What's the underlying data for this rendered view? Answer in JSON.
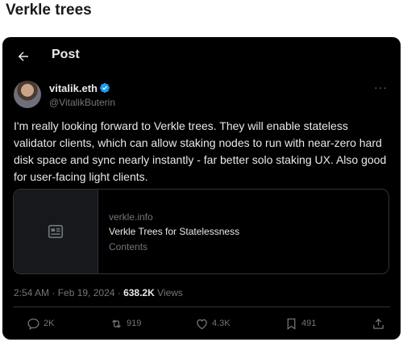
{
  "page": {
    "heading": "Verkle trees"
  },
  "nav": {
    "title": "Post",
    "back_icon": "arrow-left-icon"
  },
  "author": {
    "name": "vitalik.eth",
    "handle": "@VitalikButerin",
    "verified_color": "#1d9bf0",
    "more_label": "···"
  },
  "tweet": {
    "text": "I'm really looking forward to Verkle trees. They will enable stateless validator clients, which can allow staking nodes to run with near-zero hard disk space and sync nearly instantly - far better solo staking UX. Also good for user-facing light clients."
  },
  "link_card": {
    "domain": "verkle.info",
    "title": "Verkle Trees for Statelessness",
    "description": "Contents"
  },
  "meta": {
    "timestamp": "2:54 AM · Feb 19, 2024 · ",
    "views_count": "638.2K",
    "views_label": " Views"
  },
  "actions": {
    "replies": "2K",
    "reposts": "919",
    "likes": "4.3K",
    "bookmarks": "491"
  },
  "colors": {
    "card_bg": "#000000",
    "text": "#e7e9ea",
    "muted": "#71767b",
    "accent": "#1d9bf0"
  }
}
